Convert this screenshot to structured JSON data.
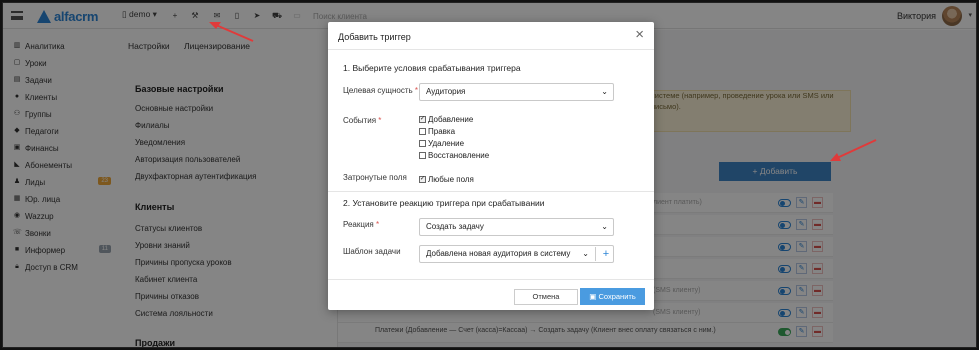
{
  "app": {
    "logo_text": "alfacrm",
    "branch_selector": "demo",
    "search_placeholder": "Поиск клиента",
    "user_name": "Виктория"
  },
  "sidebar": {
    "items": [
      {
        "label": "Аналитика",
        "icon": "analytics-icon"
      },
      {
        "label": "Уроки",
        "icon": "calendar-icon"
      },
      {
        "label": "Задачи",
        "icon": "tasks-icon"
      },
      {
        "label": "Клиенты",
        "icon": "user-icon"
      },
      {
        "label": "Группы",
        "icon": "group-icon"
      },
      {
        "label": "Педагоги",
        "icon": "graduation-icon"
      },
      {
        "label": "Финансы",
        "icon": "money-icon"
      },
      {
        "label": "Абонементы",
        "icon": "tag-icon"
      },
      {
        "label": "Лиды",
        "icon": "leads-icon",
        "badge": "23"
      },
      {
        "label": "Юр. лица",
        "icon": "building-icon"
      },
      {
        "label": "Wazzup",
        "icon": "whatsapp-icon"
      },
      {
        "label": "Звонки",
        "icon": "phone-icon"
      },
      {
        "label": "Информер",
        "icon": "informer-icon",
        "badge": "11"
      },
      {
        "label": "Доступ в CRM",
        "icon": "lock-icon"
      }
    ]
  },
  "tabs": [
    "Настройки",
    "Лицензирование"
  ],
  "settings": {
    "sections": [
      {
        "title": "Базовые настройки",
        "links": [
          "Основные настройки",
          "Филиалы",
          "Уведомления",
          "Авторизация пользователей",
          "Двухфакторная аутентификация"
        ]
      },
      {
        "title": "Клиенты",
        "links": [
          "Статусы клиентов",
          "Уровни знаний",
          "Причины пропуска уроков",
          "Кабинет клиента",
          "Причины отказов",
          "Система лояльности"
        ]
      },
      {
        "title": "Продажи",
        "links": []
      }
    ]
  },
  "background": {
    "warning_text": "системе (например, проведение урока или SMS или письмо).",
    "add_button": "+ Добавить",
    "row_fragments": [
      "лиент платить)",
      "(SMS клиенту)",
      "(SMS клиенту)"
    ],
    "last_row": "Платежи (Добавление — Счет (касса)=Кассаа) → Создать задачу (Клиент внес оплату связаться с ним.)"
  },
  "modal": {
    "title": "Добавить триггер",
    "section1": "1. Выберите условия срабатывания триггера",
    "target_label": "Целевая сущность",
    "target_value": "Аудитория",
    "events_label": "События",
    "events": [
      {
        "label": "Добавление",
        "checked": true
      },
      {
        "label": "Правка",
        "checked": false
      },
      {
        "label": "Удаление",
        "checked": false
      },
      {
        "label": "Восстановление",
        "checked": false
      }
    ],
    "fields_label": "Затронутые поля",
    "fields_option": "Любые поля",
    "section2": "2. Установите реакцию триггера при срабатывании",
    "reaction_label": "Реакция",
    "reaction_value": "Создать задачу",
    "template_label": "Шаблон задачи",
    "template_value": "Добавлена новая аудитория в систему",
    "cancel": "Отмена",
    "save": "Сохранить"
  },
  "colors": {
    "brand": "#2b84d6",
    "save": "#4a9be0",
    "annotation_arrow": "#e03a3a",
    "badge": "#f0a93b"
  }
}
